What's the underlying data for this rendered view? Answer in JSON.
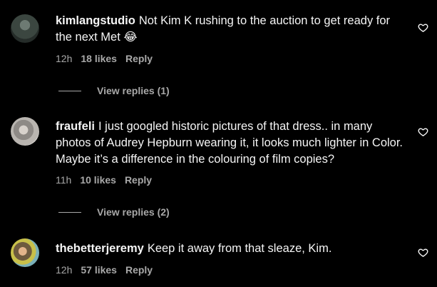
{
  "comments": [
    {
      "username": "kimlangstudio",
      "text": "Not Kim K rushing to the auction to get ready for the next Met 😂",
      "time": "12h",
      "likes": "18 likes",
      "reply": "Reply",
      "view_replies": "View replies (1)",
      "avatar_icon": "profile-photo",
      "heart_icon": "heart-outline-icon"
    },
    {
      "username": "fraufeli",
      "text": "I just googled historic pictures of that dress.. in many photos of Audrey Hepburn wearing it, it looks much lighter in Color. Maybe it’s a difference in the colouring of film copies?",
      "time": "11h",
      "likes": "10 likes",
      "reply": "Reply",
      "view_replies": "View replies (2)",
      "avatar_icon": "profile-photo",
      "heart_icon": "heart-outline-icon"
    },
    {
      "username": "thebetterjeremy",
      "text": "Keep it away from that sleaze, Kim.",
      "time": "12h",
      "likes": "57 likes",
      "reply": "Reply",
      "avatar_icon": "profile-photo",
      "heart_icon": "heart-outline-icon"
    }
  ],
  "colors": {
    "background": "#000000",
    "text": "#f5f5f5",
    "secondary": "#a8a8a8"
  }
}
